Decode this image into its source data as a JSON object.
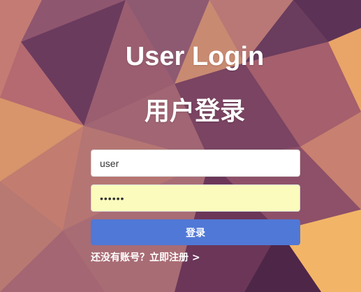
{
  "page": {
    "title_en": "User Login",
    "title_zh": "用户登录"
  },
  "form": {
    "username_value": "user",
    "password_value": "••••••",
    "submit_label": "登录",
    "register_link": "还没有账号？立即注册 >"
  },
  "colors": {
    "button": "#5078d6",
    "password_field_bg": "#fafbbd",
    "text": "#ffffff"
  }
}
